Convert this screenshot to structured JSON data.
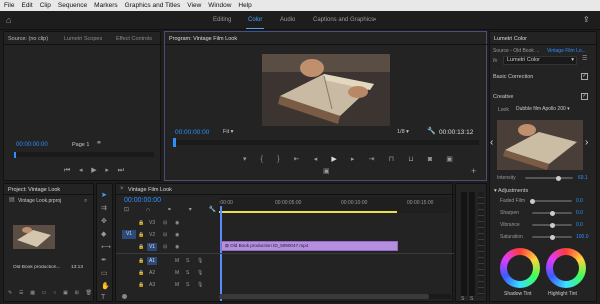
{
  "menu": {
    "items": [
      "File",
      "Edit",
      "Clip",
      "Sequence",
      "Markers",
      "Graphics and Titles",
      "View",
      "Window",
      "Help"
    ]
  },
  "workspaces": {
    "tabs": [
      "Editing",
      "Color",
      "Audio",
      "Captions and Graphics"
    ],
    "active": "Color",
    "more": "»"
  },
  "source_panel": {
    "tabs": [
      "Source: (no clip)",
      "Lumetri Scopes",
      "Effect Controls"
    ],
    "timecode": "00:00:00:00",
    "page": "Page 1"
  },
  "program": {
    "title": "Program: Vintage Film Look",
    "timecode": "00:00:00:00",
    "fit": "Fit",
    "fraction": "1/8",
    "duration": "00:00:13:12"
  },
  "lumetri": {
    "title": "Lumetri Color",
    "source": "Source - Old Book ...",
    "target": "Vintage Film Lo...",
    "fx_label": "fx",
    "effect": "Lumetri Color",
    "basic_correction": "Basic Correction",
    "creative": "Creative",
    "look_label": "Look",
    "look_value": "Dubble film Apollo 200",
    "intensity_label": "Intensity",
    "intensity_value": "69.1",
    "intensity_fraction": 0.69,
    "adjustments": "Adjustments",
    "params": [
      {
        "label": "Faded Film",
        "value": "0.0",
        "fraction": 0.0
      },
      {
        "label": "Sharpen",
        "value": "0.0",
        "fraction": 0.5
      },
      {
        "label": "Vibrance",
        "value": "0.0",
        "fraction": 0.5
      },
      {
        "label": "Saturation",
        "value": "100.0",
        "fraction": 0.5
      }
    ],
    "shadow_tint": "Shadow Tint",
    "highlight_tint": "Highlight Tint"
  },
  "project": {
    "title": "Project: Vintage Look",
    "file": "Vintage Look.prproj",
    "clip_name": "Old Book production...",
    "clip_duration": "13:13"
  },
  "timeline": {
    "title": "Vintage Film Look",
    "timecode": "00:00:00:00",
    "ruler": [
      ":00:00",
      "00:00:05:00",
      "00:00:10:00",
      "00:00:15:00"
    ],
    "video_tracks": [
      "V3",
      "V2",
      "V1"
    ],
    "audio_tracks": [
      "A1",
      "A2",
      "A3"
    ],
    "source_patch": "V1",
    "clip_label": "Old Book production ID_5090047.mp4"
  },
  "colors": {
    "accent": "#2f8fff",
    "clip": "#b58ee0",
    "playhead": "#5b8cff"
  }
}
